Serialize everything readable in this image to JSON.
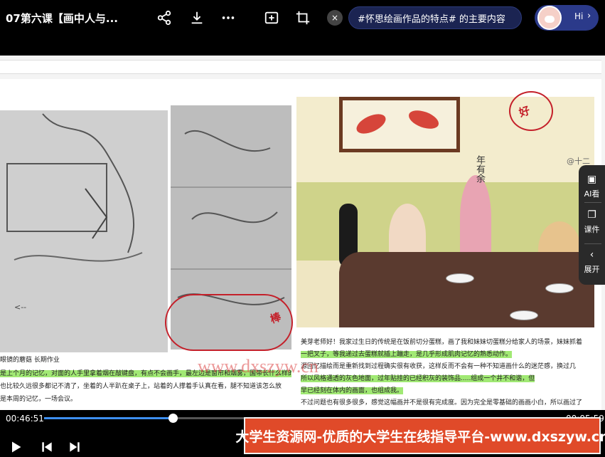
{
  "header": {
    "title": "07第六课【画中人与...",
    "ai_question": "#怀思绘画作品的特点# 的主要内容",
    "ai_close": "×",
    "hi_label": "Hi",
    "hi_chevron": "›"
  },
  "icons": [
    "share-icon",
    "download-icon",
    "more-icon",
    "screen-cast-icon",
    "crop-icon"
  ],
  "slide": {
    "painting_signature": "@十二",
    "painting_inscription": "年有余",
    "mark_good": "好",
    "mark_bang": "棒",
    "left_caption_1": "眼镜的蘑菇 长期作业",
    "left_caption_2": "是上个月的记忆，对面的人手里拿着烟在敲键盘，有点不会画手，最左边是窗帘和烟雾，国带长什么样的来都风格道理的东西",
    "left_caption_3": "也比较久远很多都记不清了，坐着的人半趴在桌子上，站着的人撑着手认真在看，腿不知道该怎么放",
    "left_caption_4": "是本周的记忆，一场会议。",
    "right_text_1": "美芽老师好！我家过生日的传统是在饭前切分蛋糕，画了我和妹妹切蛋糕分给家人的场景，妹妹抓着",
    "right_text_2": "一把叉子，等我递过去蛋糕就插上蹦走，是几乎形成肌肉记忆的熟悉动作。",
    "right_text_3": "源回忆描绘而是重新找到过程确实很有收获，这样反而不会有一种不知道画什么的迷茫感，换过几",
    "right_text_4": "所以风格通透的灰色地面，过年贴挂的已经积灰的装饰品.....组成一个井不和谐，但",
    "right_text_5": "早已经刻在体内的画面，也组成我。",
    "right_text_6": "不过问题也有很多很多，感觉这幅画并不是很有完成度。因为完全是零基础的画画小白，所以画过了",
    "watermark": "www.dxszyw.cn"
  },
  "side_panel": {
    "ai_label": "AI看",
    "courseware_label": "课件",
    "expand_label": "展开",
    "expand_icon": "‹"
  },
  "player": {
    "current_time": "00:46:51",
    "total_time": "00:05:59",
    "progress_fraction": 0.248
  },
  "banner": {
    "text": "大学生资源网-优质的大学生在线指导平台-www.dxszyw.cn"
  },
  "colors": {
    "accent": "#3d8ff0",
    "banner_bg": "#e04a29",
    "highlight": "#82e246",
    "ink_red": "#c4202a"
  }
}
